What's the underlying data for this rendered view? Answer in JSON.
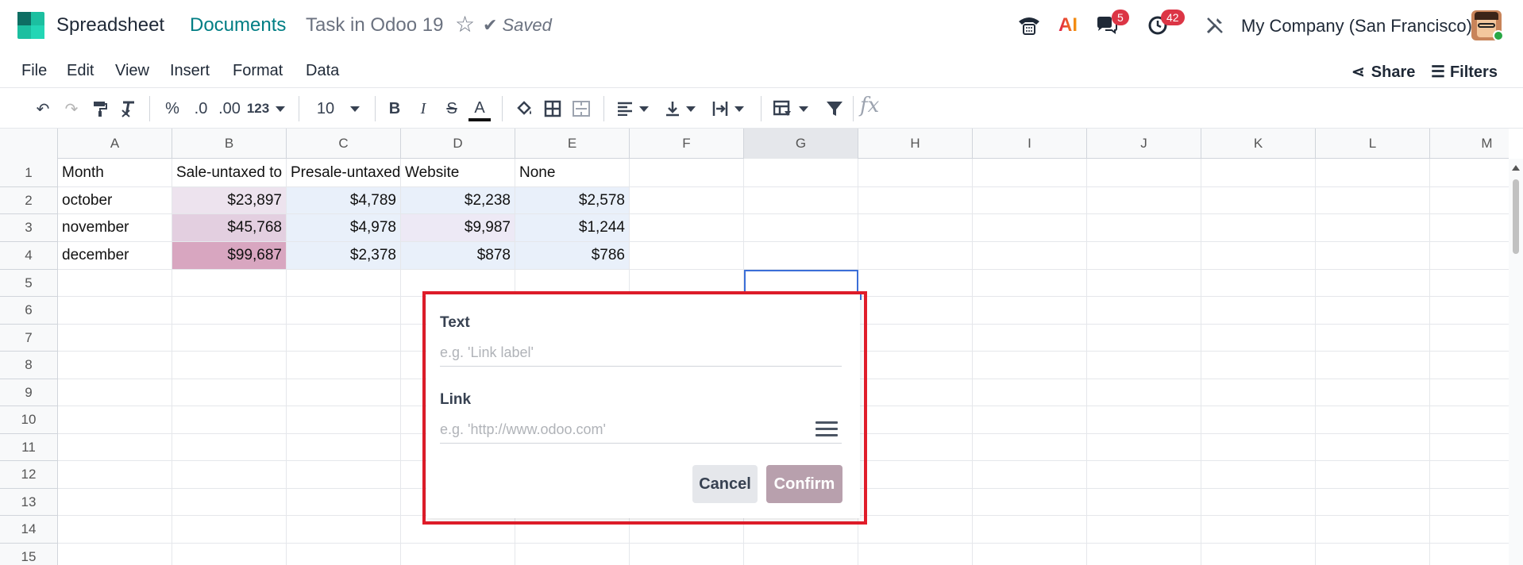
{
  "topbar": {
    "app_name": "Spreadsheet",
    "breadcrumb_link": "Documents",
    "breadcrumb_current": "Task in Odoo 19",
    "saved_label": "Saved",
    "messages_badge": "5",
    "activities_badge": "42",
    "ai_label": "AI",
    "company": "My Company (San Francisco)",
    "badge_color": "#dc3545",
    "accent_color": "#017e84"
  },
  "menu": {
    "items": [
      "File",
      "Edit",
      "View",
      "Insert",
      "Format",
      "Data"
    ],
    "share_label": "Share",
    "filters_label": "Filters"
  },
  "toolbar": {
    "percent": "%",
    "decimal_decrease": ".0",
    "decimal_increase": ".00",
    "number_format": "123",
    "font_size": "10",
    "bold": "B",
    "italic": "I",
    "strike": "S",
    "text_color": "A",
    "formula_placeholder": "fx"
  },
  "grid": {
    "columns": [
      "A",
      "B",
      "C",
      "D",
      "E",
      "F",
      "G",
      "H",
      "I",
      "J",
      "K",
      "L",
      "M"
    ],
    "rows": [
      "1",
      "2",
      "3",
      "4",
      "5",
      "6",
      "7",
      "8",
      "9",
      "10",
      "11",
      "12",
      "13",
      "14",
      "15"
    ],
    "active_column": "G",
    "selected_cell": "G5",
    "data": [
      [
        "Month",
        "Sale-untaxed to",
        "Presale-untaxed",
        "Website",
        "None"
      ],
      [
        "october",
        "$23,897",
        "$4,789",
        "$2,238",
        "$2,578"
      ],
      [
        "november",
        "$45,768",
        "$4,978",
        "$9,987",
        "$1,244"
      ],
      [
        "december",
        "$99,687",
        "$2,378",
        "$878",
        "$786"
      ]
    ],
    "cell_colors": {
      "B2": "#ede3ee",
      "B3": "#e3cfe0",
      "B4": "#d8a6c0",
      "C2": "#e9f0fa",
      "C3": "#e9f0fa",
      "C4": "#e9f0fa",
      "D2": "#e9f0fa",
      "D3": "#ede9f5",
      "D4": "#e9f0fa",
      "E2": "#e9f0fa",
      "E3": "#e9f0fa",
      "E4": "#e9f0fa"
    }
  },
  "dialog": {
    "text_label": "Text",
    "text_placeholder": "e.g. 'Link label'",
    "text_value": "",
    "link_label": "Link",
    "link_placeholder": "e.g. 'http://www.odoo.com'",
    "link_value": "",
    "cancel_label": "Cancel",
    "confirm_label": "Confirm",
    "highlight_color": "#e11d2a",
    "confirm_color": "#b8a0ad"
  }
}
